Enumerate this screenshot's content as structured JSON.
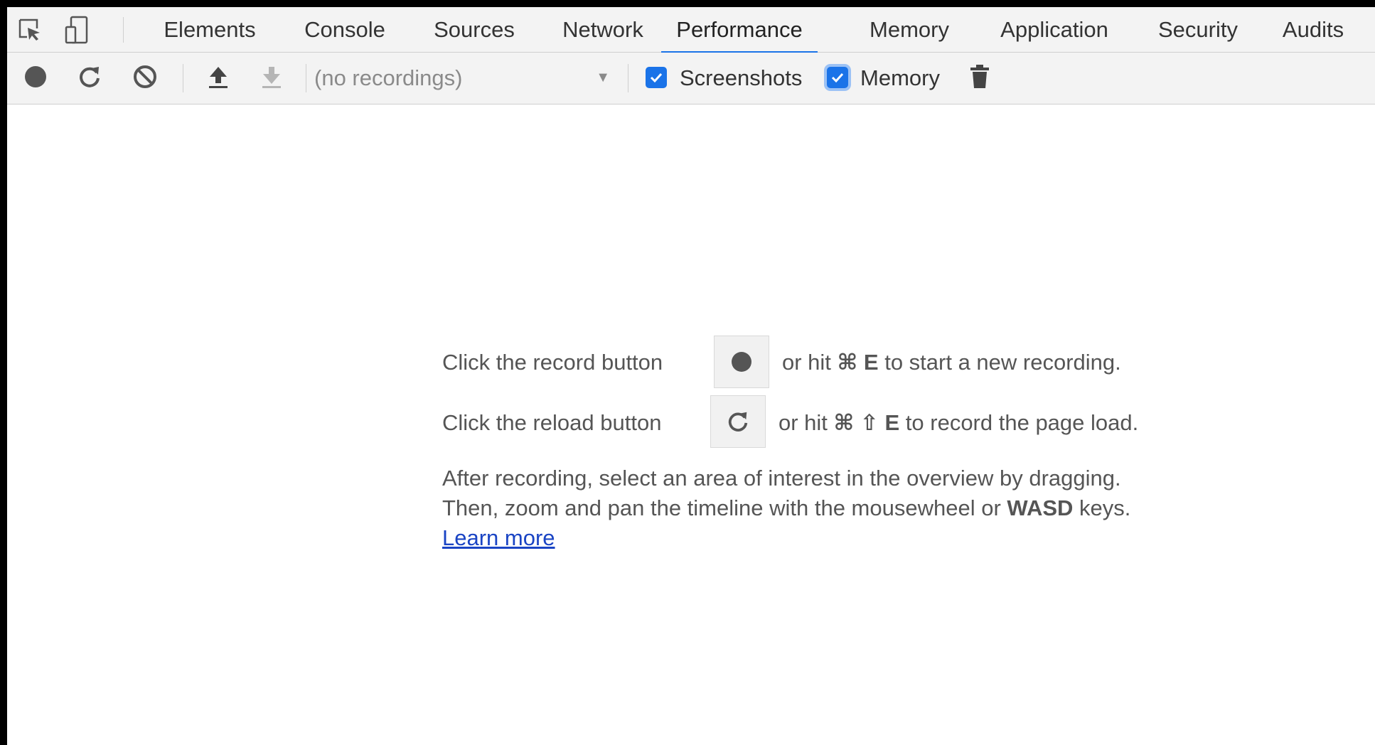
{
  "tabs": [
    {
      "label": "Elements"
    },
    {
      "label": "Console"
    },
    {
      "label": "Sources"
    },
    {
      "label": "Network"
    },
    {
      "label": "Performance",
      "active": true
    },
    {
      "label": "Memory"
    },
    {
      "label": "Application"
    },
    {
      "label": "Security"
    },
    {
      "label": "Audits"
    }
  ],
  "toolbar": {
    "recordings_value": "(no recordings)",
    "screenshots_label": "Screenshots",
    "screenshots_checked": true,
    "memory_label": "Memory",
    "memory_checked": true
  },
  "landing": {
    "record_prefix": "Click the record button",
    "record_suffix_pre": "or hit ",
    "record_shortcut": "⌘ E",
    "record_suffix_post": " to start a new recording.",
    "reload_prefix": "Click the reload button",
    "reload_suffix_pre": "or hit ",
    "reload_shortcut": "⌘ ⇧ E",
    "reload_suffix_post": " to record the page load.",
    "hint_line1": "After recording, select an area of interest in the overview by dragging.",
    "hint_line2_pre": "Then, zoom and pan the timeline with the mousewheel or ",
    "hint_line2_bold": "WASD",
    "hint_line2_post": " keys.",
    "learn_more": "Learn more"
  },
  "colors": {
    "accent": "#1a73e8",
    "link": "#1a44c4",
    "toolbar_bg": "#f3f3f3"
  },
  "icons": {
    "inspect": "inspect-element-icon",
    "device": "device-toolbar-icon",
    "record": "record-icon",
    "reload": "reload-icon",
    "clear": "clear-icon",
    "load": "upload-icon",
    "save": "download-icon",
    "gc": "trash-icon"
  }
}
